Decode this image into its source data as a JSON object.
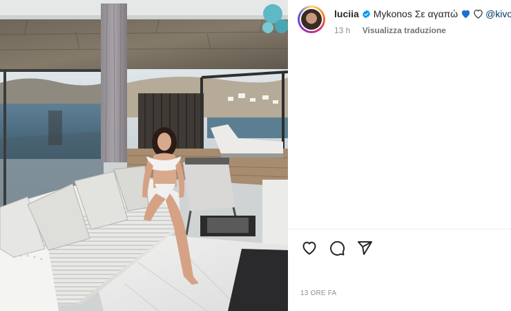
{
  "post": {
    "username": "luciia",
    "caption": "Mykonos Σε αγαπώ",
    "mention": "@kivo",
    "time_ago": "13 h",
    "translate_label": "Visualizza traduzione",
    "timestamp": "13 ORE FA",
    "verified": true
  },
  "icons": {
    "verified": "verified-badge-icon",
    "heart_blue": "blue-heart-emoji-icon",
    "heart_white": "white-heart-emoji-icon",
    "like": "heart-icon",
    "comment": "comment-icon",
    "share": "paper-plane-icon"
  },
  "colors": {
    "verified_blue": "#0095f6",
    "mention_blue": "#00376b",
    "emoji_blue": "#1a6fd1",
    "text_primary": "#262626",
    "text_secondary": "#8e8e8e"
  },
  "media": {
    "description_alt": "photo"
  }
}
